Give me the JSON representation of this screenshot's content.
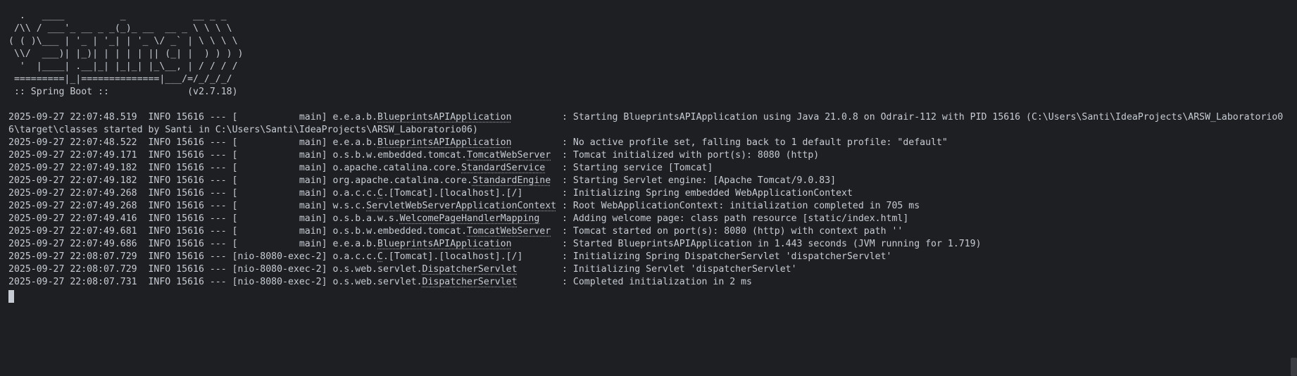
{
  "banner": {
    "art": "  .   ____          _            __ _ _\n /\\\\ / ___'_ __ _ _(_)_ __  __ _ \\ \\ \\ \\\n( ( )\\___ | '_ | '_| | '_ \\/ _` | \\ \\ \\ \\\n \\\\/  ___)| |_)| | | | | || (_| |  ) ) ) )\n  '  |____| .__|_| |_|_| |_\\__, | / / / /\n =========|_|==============|___/=/_/_/_/",
    "spring_label": " :: Spring Boot ::",
    "spring_version": "(v2.7.18)"
  },
  "logs": [
    {
      "prefix": "2025-09-27 22:07:48.519  INFO 15616 --- [           main] e.e.a.b.",
      "cls": "BlueprintsAPIApplication",
      "pad": "         ",
      "msg": ": Starting BlueprintsAPIApplication using Java 21.0.8 on Odrair-112 with PID 15616 (C:\\Users\\Santi\\IdeaProjects\\ARSW_Laboratorio0",
      "cont": "6\\target\\classes started by Santi in C:\\Users\\Santi\\IdeaProjects\\ARSW_Laboratorio06)"
    },
    {
      "prefix": "2025-09-27 22:07:48.522  INFO 15616 --- [           main] e.e.a.b.",
      "cls": "BlueprintsAPIApplication",
      "pad": "         ",
      "msg": ": No active profile set, falling back to 1 default profile: \"default\""
    },
    {
      "prefix": "2025-09-27 22:07:49.171  INFO 15616 --- [           main] o.s.b.w.embedded.tomcat.",
      "cls": "TomcatWebServer",
      "pad": "  ",
      "msg": ": Tomcat initialized with port(s): 8080 (http)"
    },
    {
      "prefix": "2025-09-27 22:07:49.182  INFO 15616 --- [           main] o.apache.catalina.core.",
      "cls": "StandardService",
      "pad": "   ",
      "msg": ": Starting service [Tomcat]"
    },
    {
      "prefix": "2025-09-27 22:07:49.182  INFO 15616 --- [           main] org.apache.catalina.core.",
      "cls": "StandardEngine",
      "pad": "  ",
      "msg": ": Starting Servlet engine: [Apache Tomcat/9.0.83]"
    },
    {
      "prefix": "2025-09-27 22:07:49.268  INFO 15616 --- [           main] o.a.c.c.",
      "cls": "C",
      "pad": "",
      "msg": ".[Tomcat].[localhost].[/]       : Initializing Spring embedded WebApplicationContext"
    },
    {
      "prefix": "2025-09-27 22:07:49.268  INFO 15616 --- [           main] w.s.c.",
      "cls": "ServletWebServerApplicationContext",
      "pad": " ",
      "msg": ": Root WebApplicationContext: initialization completed in 705 ms"
    },
    {
      "prefix": "2025-09-27 22:07:49.416  INFO 15616 --- [           main] o.s.b.a.w.s.",
      "cls": "WelcomePageHandlerMapping",
      "pad": "    ",
      "msg": ": Adding welcome page: class path resource [static/index.html]"
    },
    {
      "prefix": "2025-09-27 22:07:49.681  INFO 15616 --- [           main] o.s.b.w.embedded.tomcat.",
      "cls": "TomcatWebServer",
      "pad": "  ",
      "msg": ": Tomcat started on port(s): 8080 (http) with context path ''"
    },
    {
      "prefix": "2025-09-27 22:07:49.686  INFO 15616 --- [           main] e.e.a.b.",
      "cls": "BlueprintsAPIApplication",
      "pad": "         ",
      "msg": ": Started BlueprintsAPIApplication in 1.443 seconds (JVM running for 1.719)"
    },
    {
      "prefix": "2025-09-27 22:08:07.729  INFO 15616 --- [nio-8080-exec-2] o.a.c.c.",
      "cls": "C",
      "pad": "",
      "msg": ".[Tomcat].[localhost].[/]       : Initializing Spring DispatcherServlet 'dispatcherServlet'"
    },
    {
      "prefix": "2025-09-27 22:08:07.729  INFO 15616 --- [nio-8080-exec-2] o.s.web.servlet.",
      "cls": "DispatcherServlet",
      "pad": "        ",
      "msg": ": Initializing Servlet 'dispatcherServlet'"
    },
    {
      "prefix": "2025-09-27 22:08:07.731  INFO 15616 --- [nio-8080-exec-2] o.s.web.servlet.",
      "cls": "DispatcherServlet",
      "pad": "        ",
      "msg": ": Completed initialization in 2 ms"
    }
  ]
}
